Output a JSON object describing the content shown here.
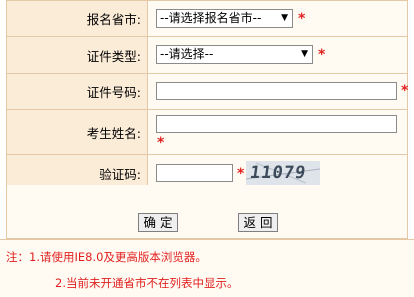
{
  "form": {
    "province": {
      "label": "报名省市:",
      "value": "--请选择报名省市--",
      "required": "*"
    },
    "cert_type": {
      "label": "证件类型:",
      "value": "--请选择--",
      "required": "*"
    },
    "cert_no": {
      "label": "证件号码:",
      "value": "",
      "required": "*"
    },
    "name": {
      "label": "考生姓名:",
      "value": "",
      "required": "*"
    },
    "captcha": {
      "label": "验证码:",
      "value": "",
      "required": "*",
      "image_text": "11079"
    }
  },
  "buttons": {
    "confirm": "确 定",
    "back": "返 回"
  },
  "notes": {
    "line1": "注：1.请使用IE8.0及更高版本浏览器。",
    "line2": "2.当前未开通省市不在列表中显示。"
  },
  "icons": {
    "dropdown_arrow": "chevron-down-icon"
  },
  "colors": {
    "required": "#e02020",
    "label_bg": "#fbecd8",
    "row_bg": "#fffbf3",
    "border": "#e5c9a6"
  }
}
